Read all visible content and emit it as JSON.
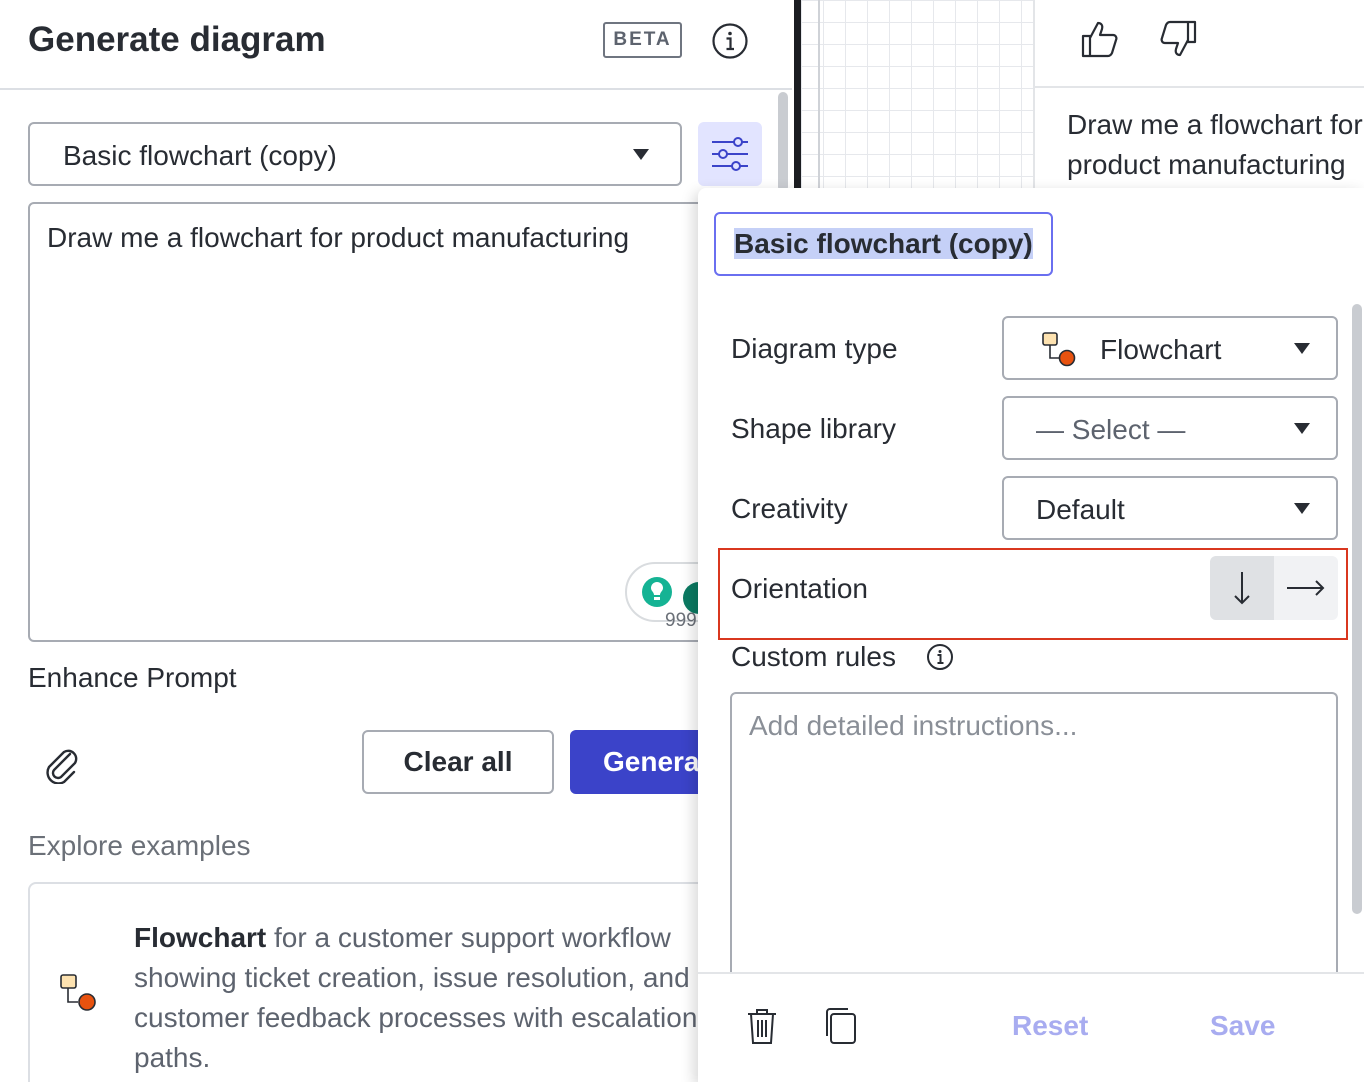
{
  "header": {
    "title": "Generate diagram",
    "badge": "BETA"
  },
  "preset_select": {
    "value": "Basic flowchart (copy)"
  },
  "prompt": {
    "text": "Draw me a flowchart for product manufacturing",
    "grammar_count": "999"
  },
  "enhance_label": "Enhance Prompt",
  "buttons": {
    "clear_all": "Clear all",
    "generate": "Generate"
  },
  "explore": {
    "heading": "Explore examples",
    "example": {
      "type_bold": "Flowchart",
      "description": " for a customer support workflow showing ticket creation, issue resolution, and customer feedback processes with escalation paths."
    }
  },
  "chat": {
    "message": "Draw me a flowchart for product manufacturing"
  },
  "settings": {
    "preset_name": "Basic flowchart (copy)",
    "diagram_type": {
      "label": "Diagram type",
      "value": "Flowchart"
    },
    "shape_library": {
      "label": "Shape library",
      "value": "— Select —"
    },
    "creativity": {
      "label": "Creativity",
      "value": "Default"
    },
    "orientation": {
      "label": "Orientation",
      "selected": "vertical"
    },
    "custom_rules": {
      "label": "Custom rules",
      "placeholder": "Add detailed instructions..."
    },
    "reset": "Reset",
    "save": "Save"
  },
  "colors": {
    "primary": "#3b43c9",
    "highlight_outline": "#d9371f",
    "disabled_action": "#a8acf0",
    "settings_active_bg": "#e2e4ff"
  },
  "icons": [
    "info-icon",
    "sliders-icon",
    "paperclip-icon",
    "flowchart-icon",
    "thumbs-up-icon",
    "thumbs-down-icon",
    "arrow-down-icon",
    "arrow-right-icon",
    "trash-icon",
    "copy-icon",
    "grammarly-icon"
  ]
}
